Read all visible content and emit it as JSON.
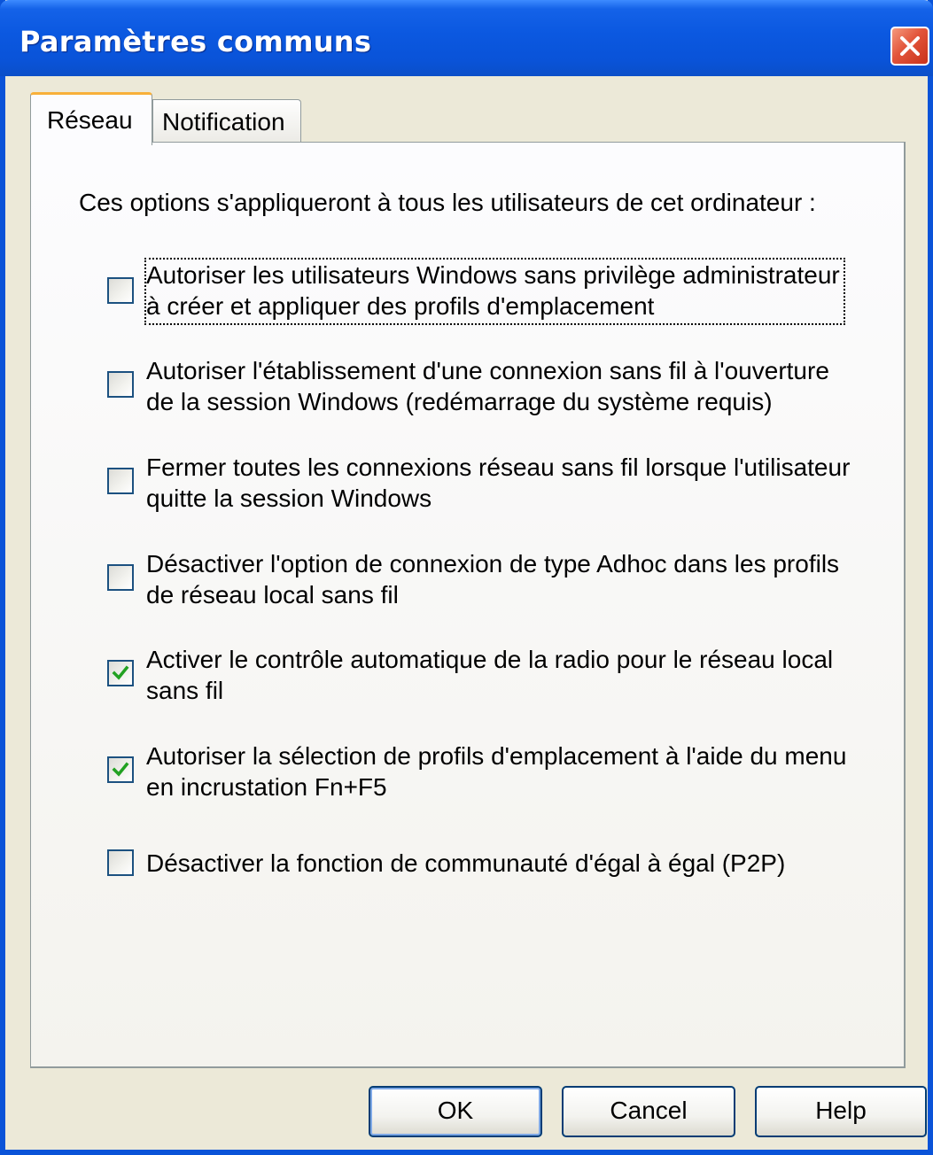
{
  "window": {
    "title": "Paramètres communs"
  },
  "tabs": [
    {
      "label": "Réseau",
      "active": true
    },
    {
      "label": "Notification",
      "active": false
    }
  ],
  "intro_text": "Ces options s'appliqueront à tous les utilisateurs de cet ordinateur :",
  "options": [
    {
      "lines": [
        "Autoriser les utilisateurs Windows sans privilège administrateur",
        "à créer et appliquer des profils d'emplacement"
      ],
      "checked": false,
      "focused": true
    },
    {
      "lines": [
        "Autoriser l'établissement d'une connexion sans fil à l'ouverture",
        "de la session Windows (redémarrage du système requis)"
      ],
      "checked": false
    },
    {
      "lines": [
        "Fermer toutes les connexions réseau sans fil lorsque l'utilisateur",
        "quitte la session Windows"
      ],
      "checked": false
    },
    {
      "lines": [
        "Désactiver l'option de connexion de type Adhoc dans les profils",
        "de réseau local sans fil"
      ],
      "checked": false
    },
    {
      "lines": [
        "Activer le contrôle automatique de la radio pour le réseau local",
        "sans fil"
      ],
      "checked": true
    },
    {
      "lines": [
        "Autoriser la sélection de profils d'emplacement à l'aide du menu",
        "en incrustation Fn+F5"
      ],
      "checked": true
    },
    {
      "lines": [
        "Désactiver la fonction de communauté d'égal à égal (P2P)"
      ],
      "checked": false
    }
  ],
  "buttons": {
    "ok": "OK",
    "cancel": "Cancel",
    "help": "Help"
  },
  "colors": {
    "titlebar": "#0a53d8",
    "dialog_bg": "#ece9d8",
    "tab_highlight": "#f8b03a",
    "check_mark": "#21a121",
    "close_button": "#e2543a"
  },
  "icons": {
    "close": "close-icon",
    "check": "checkmark-icon"
  }
}
